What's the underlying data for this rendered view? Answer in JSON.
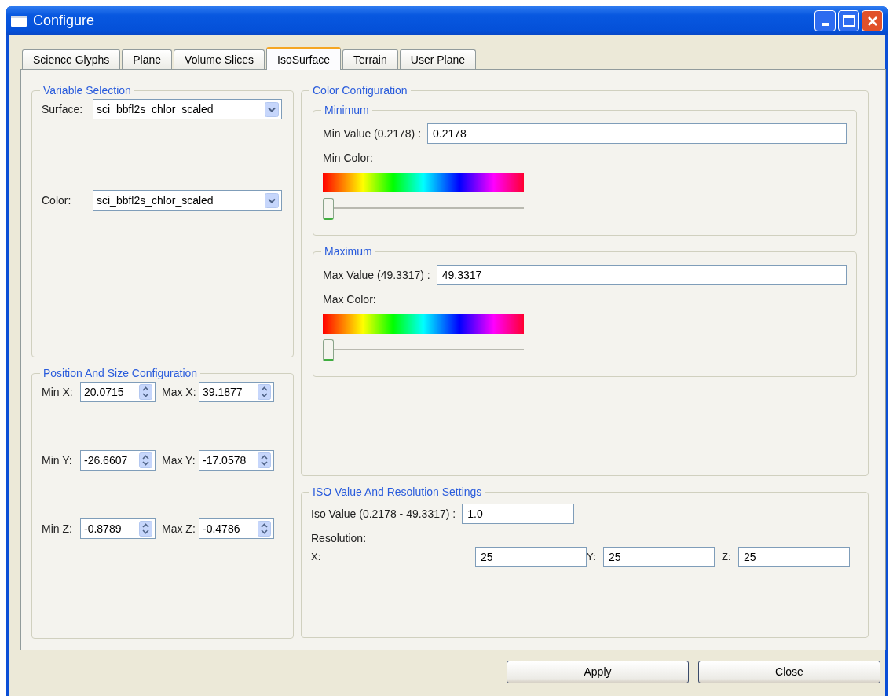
{
  "window": {
    "title": "Configure"
  },
  "tabs": [
    {
      "label": "Science Glyphs",
      "selected": false
    },
    {
      "label": "Plane",
      "selected": false
    },
    {
      "label": "Volume Slices",
      "selected": false
    },
    {
      "label": "IsoSurface",
      "selected": true
    },
    {
      "label": "Terrain",
      "selected": false
    },
    {
      "label": "User Plane",
      "selected": false
    }
  ],
  "variable_selection": {
    "title": "Variable Selection",
    "fields": [
      {
        "label": "Surface:",
        "value": "sci_bbfl2s_chlor_scaled"
      },
      {
        "label": "Color:",
        "value": "sci_bbfl2s_chlor_scaled"
      }
    ]
  },
  "position_and_size": {
    "title": "Position And Size Configuration",
    "rows": [
      {
        "min_label": "Min X:",
        "min_value": "20.0715",
        "max_label": "Max X:",
        "max_value": "39.1877"
      },
      {
        "min_label": "Min Y:",
        "min_value": "-26.6607",
        "max_label": "Max Y:",
        "max_value": "-17.0578"
      },
      {
        "min_label": "Min Z:",
        "min_value": "-0.8789",
        "max_label": "Max Z:",
        "max_value": "-0.4786"
      }
    ]
  },
  "color_configuration": {
    "title": "Color Configuration",
    "groups": [
      {
        "title": "Minimum",
        "value_label": "Min Value (0.2178) :",
        "value": "0.2178",
        "color_label": "Min Color:",
        "level": 0
      },
      {
        "title": "Maximum",
        "value_label": "Max Value (49.3317) :",
        "value": "49.3317",
        "color_label": "Max Color:",
        "level": 0
      }
    ]
  },
  "iso_settings": {
    "title": "ISO Value And Resolution Settings",
    "iso_label": "Iso Value (0.2178 - 49.3317) :",
    "iso_value": "1.0",
    "resolution_label": "Resolution:",
    "axes": [
      {
        "label": "X:",
        "value": "25"
      },
      {
        "label": "Y:",
        "value": "25"
      },
      {
        "label": "Z:",
        "value": "25"
      }
    ]
  },
  "buttons": [
    "Apply",
    "Close"
  ]
}
